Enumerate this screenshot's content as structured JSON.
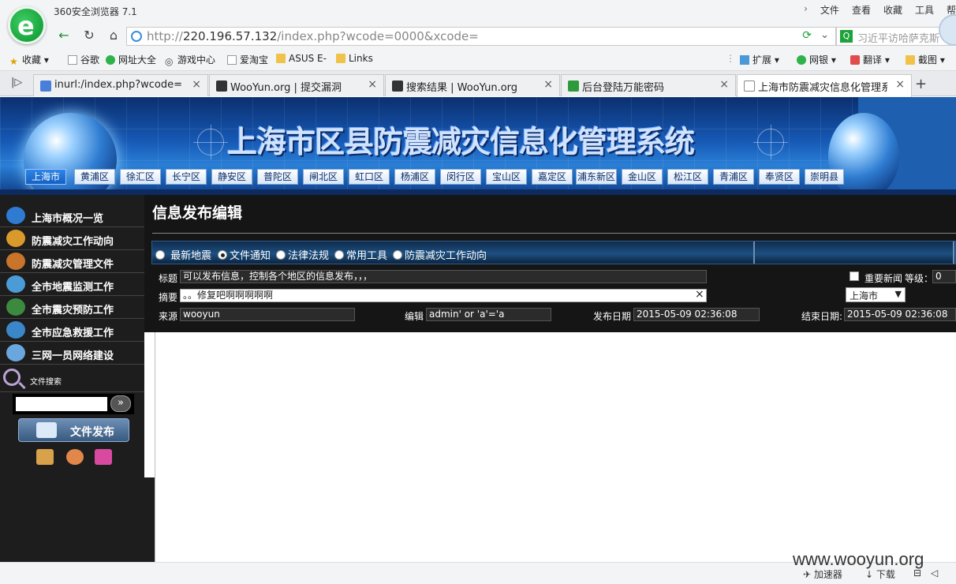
{
  "browser": {
    "app_title": "360安全浏览器 7.1",
    "menu": [
      "文件",
      "查看",
      "收藏",
      "工具",
      "帮"
    ],
    "url_prefix": "http://",
    "url_host": "220.196.57.132",
    "url_path": "/index.php?wcode=0000&xcode=",
    "search_text": "习近平访哈萨克斯",
    "favorites": [
      "收藏",
      "谷歌",
      "网址大全",
      "游戏中心",
      "爱淘宝",
      "ASUS E-",
      "Links"
    ],
    "extensions": [
      "扩展",
      "网银",
      "翻译",
      "截图"
    ],
    "tabs": [
      {
        "label": "inurl:/index.php?wcode= - G",
        "icon_color": "#4a7fd9",
        "active": false
      },
      {
        "label": "WooYun.org | 提交漏洞",
        "icon_color": "#333333",
        "active": false
      },
      {
        "label": "搜索结果 | WooYun.org",
        "icon_color": "#333333",
        "active": false
      },
      {
        "label": "后台登陆万能密码",
        "icon_color": "#2f9a3c",
        "active": false
      },
      {
        "label": "上海市防震减灾信息化管理系统",
        "icon_color": "#888888",
        "active": true
      }
    ],
    "status_items": [
      "加速器",
      "下载"
    ],
    "watermark": "www.wooyun.org"
  },
  "banner": {
    "title": "上海市区县防震减灾信息化管理系统",
    "districts": [
      "上海市",
      "黄浦区",
      "徐汇区",
      "长宁区",
      "静安区",
      "普陀区",
      "闸北区",
      "虹口区",
      "杨浦区",
      "闵行区",
      "宝山区",
      "嘉定区",
      "浦东新区",
      "金山区",
      "松江区",
      "青浦区",
      "奉贤区",
      "崇明县"
    ],
    "active_district": "上海市"
  },
  "sidebar": {
    "items": [
      {
        "label": "上海市概况一览",
        "icon": "globe-icon",
        "color": "#2e7bd1"
      },
      {
        "label": "防震减灾工作动向",
        "icon": "hourglass-icon",
        "color": "#d99a2b"
      },
      {
        "label": "防震减灾管理文件",
        "icon": "books-icon",
        "color": "#c8742b"
      },
      {
        "label": "全市地震监测工作",
        "icon": "telescope-icon",
        "color": "#4b9cd6"
      },
      {
        "label": "全市震灾预防工作",
        "icon": "globe-tools-icon",
        "color": "#3c8a3f"
      },
      {
        "label": "全市应急救援工作",
        "icon": "globe-aid-icon",
        "color": "#3b86c9"
      },
      {
        "label": "三网一员网络建设",
        "icon": "network-icon",
        "color": "#6aa7df"
      }
    ],
    "file_search_label": "文件搜索",
    "search_button": "»",
    "publish_label": "文件发布"
  },
  "form": {
    "page_title": "信息发布编辑",
    "radio_options": [
      {
        "label": "最新地震",
        "checked": false
      },
      {
        "label": "文件通知",
        "checked": true
      },
      {
        "label": "法律法规",
        "checked": false
      },
      {
        "label": "常用工具",
        "checked": false
      },
      {
        "label": "防震减灾工作动向",
        "checked": false
      }
    ],
    "title_label": "标题",
    "title_value": "可以发布信息，控制各个地区的信息发布，，，",
    "important_label": "重要新闻",
    "level_label": "等级：",
    "level_value": "0",
    "summary_label": "摘要",
    "summary_value": "。。修复吧啊啊啊啊啊",
    "summary_clear": "×",
    "region_value": "上海市",
    "source_label": "来源",
    "source_value": "wooyun",
    "editor_label": "编辑",
    "editor_value": "admin' or 'a'='a",
    "publish_date_label": "发布日期",
    "publish_date_value": "2015-05-09 02:36:08",
    "end_date_label": "结束日期:",
    "end_date_value": "2015-05-09 02:36:08"
  }
}
